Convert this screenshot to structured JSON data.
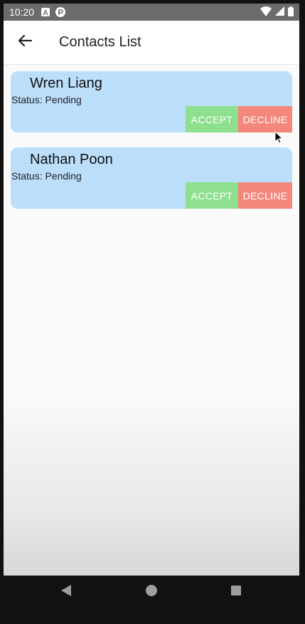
{
  "status_bar": {
    "time": "10:20",
    "icons": [
      "a-notification-icon",
      "circle-notification-icon",
      "wifi-icon",
      "signal-icon",
      "battery-icon"
    ]
  },
  "app_bar": {
    "title": "Contacts List",
    "back_icon": "arrow-back-icon"
  },
  "contacts": [
    {
      "name": "Wren Liang",
      "status": "Status: Pending",
      "accept_label": "ACCEPT",
      "decline_label": "DECLINE"
    },
    {
      "name": "Nathan Poon",
      "status": "Status: Pending",
      "accept_label": "ACCEPT",
      "decline_label": "DECLINE"
    }
  ],
  "nav_bar": {
    "buttons": [
      "back-triangle-icon",
      "home-circle-icon",
      "recents-square-icon"
    ]
  },
  "colors": {
    "card_bg": "#bbdefb",
    "accept_bg": "#8ee08e",
    "decline_bg": "#f4877c",
    "status_bar_bg": "#6b6b6b",
    "app_bar_bg": "#ffffff"
  }
}
